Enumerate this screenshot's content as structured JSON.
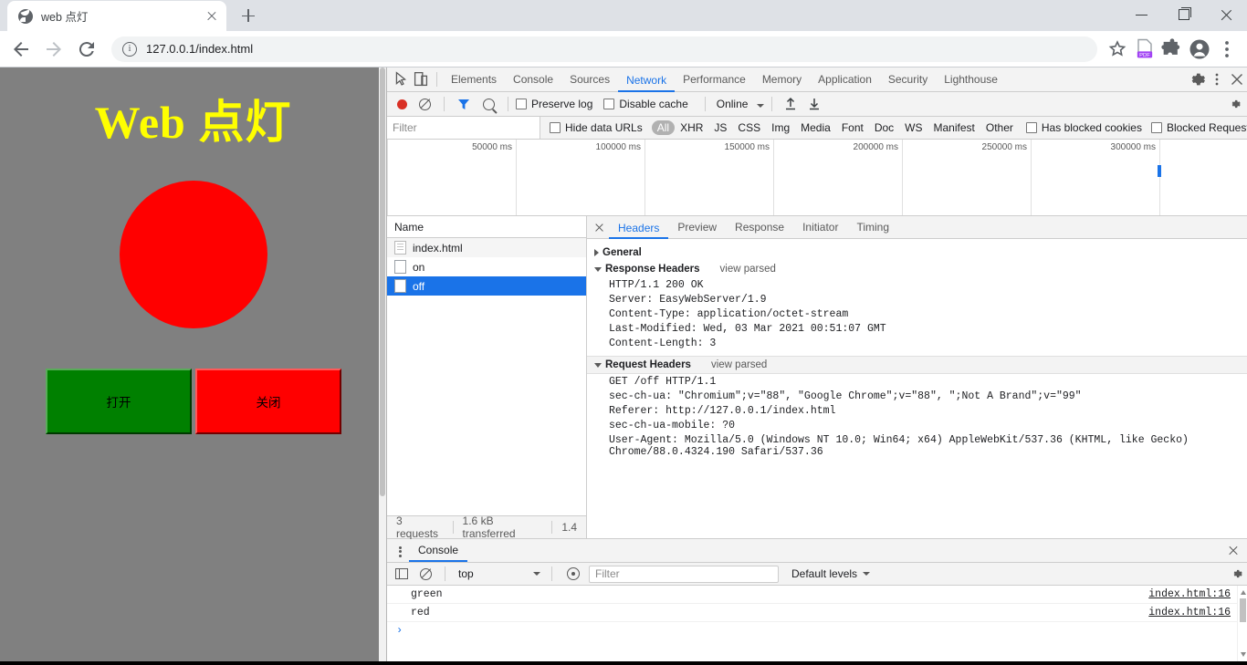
{
  "browser": {
    "tab": {
      "title": "web 点灯",
      "favicon": "globe-icon",
      "close": "×"
    },
    "newtab_label": "+",
    "window_controls": {
      "minimize": "—",
      "maximize": "□",
      "close": "×"
    },
    "omnibox": {
      "url": "127.0.0.1/index.html",
      "security_icon": "info-circle-icon"
    },
    "toolbar_icons": [
      "back-arrow-icon",
      "forward-arrow-icon",
      "reload-icon",
      "bookmark-star-icon",
      "pdf-icon",
      "extensions-puzzle-icon",
      "profile-avatar-icon",
      "chrome-menu-icon"
    ]
  },
  "page": {
    "title": "Web 点灯",
    "lamp_color": "#ff0000",
    "background_color": "#808080",
    "title_color": "#ffff00",
    "buttons": [
      {
        "label": "打开",
        "color": "#008000"
      },
      {
        "label": "关闭",
        "color": "#ff0000"
      }
    ]
  },
  "devtools": {
    "panel_tabs": [
      "Elements",
      "Console",
      "Sources",
      "Network",
      "Performance",
      "Memory",
      "Application",
      "Security",
      "Lighthouse"
    ],
    "active_panel": "Network",
    "left_icons": [
      "inspect-element-icon",
      "device-toolbar-icon"
    ],
    "right_icons": [
      "settings-gear-icon",
      "more-options-icon",
      "close-devtools-icon"
    ],
    "network_toolbar": {
      "record_icon": "record-dot-icon",
      "clear_icon": "clear-icon",
      "filter_icon": "filter-funnel-icon",
      "search_icon": "search-icon",
      "preserve_log": "Preserve log",
      "disable_cache": "Disable cache",
      "throttling": "Online",
      "import_icon": "import-har-icon",
      "export_icon": "export-har-icon",
      "settings_icon": "network-settings-gear-icon"
    },
    "filter_bar": {
      "filter_placeholder": "Filter",
      "hide_data_urls": "Hide data URLs",
      "types": [
        "All",
        "XHR",
        "JS",
        "CSS",
        "Img",
        "Media",
        "Font",
        "Doc",
        "WS",
        "Manifest",
        "Other"
      ],
      "active_type": "All",
      "has_blocked_cookies": "Has blocked cookies",
      "blocked_requests": "Blocked Requests"
    },
    "overview": {
      "ticks": [
        "50000 ms",
        "100000 ms",
        "150000 ms",
        "200000 ms",
        "250000 ms",
        "300000 ms"
      ]
    },
    "request_list": {
      "column_header": "Name",
      "rows": [
        {
          "name": "index.html",
          "icon": "document-icon",
          "selected": false
        },
        {
          "name": "on",
          "icon": "generic-file-icon",
          "selected": false
        },
        {
          "name": "off",
          "icon": "generic-file-icon",
          "selected": true
        }
      ]
    },
    "status_bar": {
      "requests": "3 requests",
      "transferred": "1.6 kB transferred",
      "resources": "1.4"
    },
    "detail": {
      "tabs": [
        "Headers",
        "Preview",
        "Response",
        "Initiator",
        "Timing"
      ],
      "active_tab": "Headers",
      "sections": {
        "general": "General",
        "response_headers": "Response Headers",
        "request_headers": "Request Headers",
        "view_parsed": "view parsed"
      },
      "response_headers": [
        "HTTP/1.1 200 OK",
        "Server: EasyWebServer/1.9",
        "Content-Type: application/octet-stream",
        "Last-Modified: Wed, 03 Mar 2021 00:51:07 GMT",
        "Content-Length: 3"
      ],
      "request_headers": [
        "GET /off HTTP/1.1",
        "sec-ch-ua: \"Chromium\";v=\"88\", \"Google Chrome\";v=\"88\", \";Not A Brand\";v=\"99\"",
        "Referer: http://127.0.0.1/index.html",
        "sec-ch-ua-mobile: ?0",
        "User-Agent: Mozilla/5.0 (Windows NT 10.0; Win64; x64) AppleWebKit/537.36 (KHTML, like Gecko) Chrome/88.0.4324.190 Safari/537.36"
      ]
    },
    "console_drawer": {
      "tab": "Console",
      "context": "top",
      "filter_placeholder": "Filter",
      "levels": "Default levels",
      "messages": [
        {
          "text": "green",
          "source": "index.html:16"
        },
        {
          "text": "red",
          "source": "index.html:16"
        }
      ],
      "prompt": "›"
    }
  }
}
